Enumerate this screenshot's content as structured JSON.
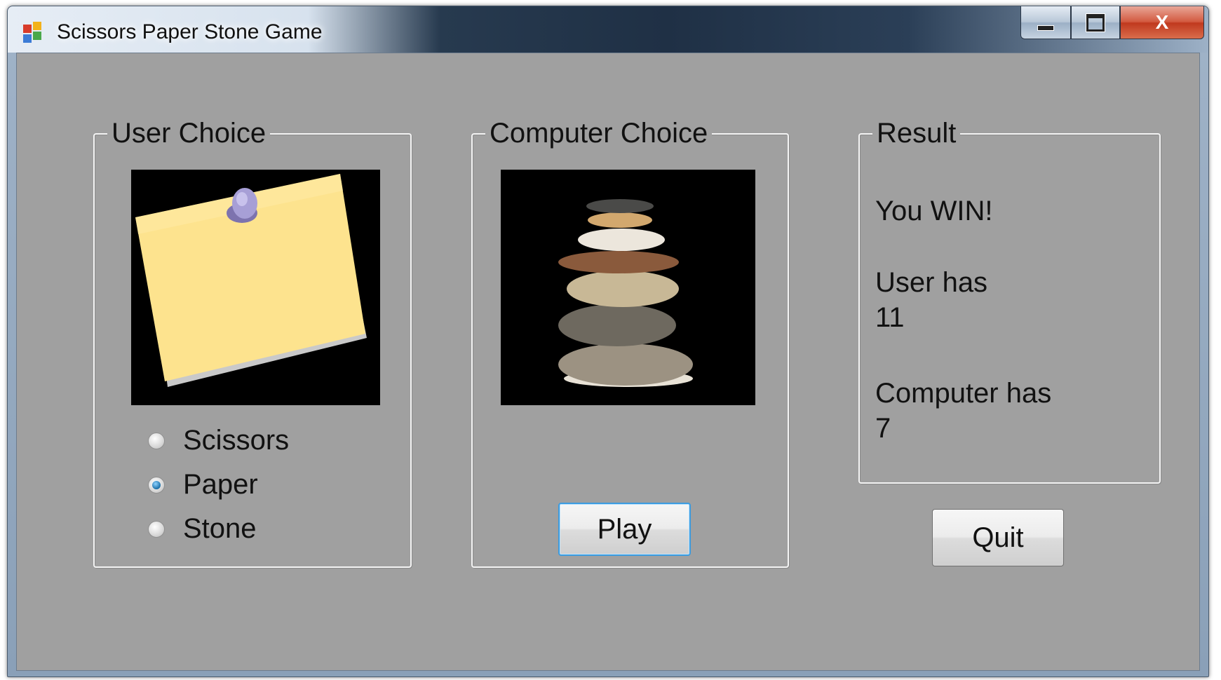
{
  "window": {
    "title": "Scissors Paper Stone Game",
    "icon": "windows-forms-app-icon",
    "buttons": {
      "minimize": "minimize-icon",
      "maximize": "maximize-icon",
      "close_label": "X"
    }
  },
  "user_group": {
    "title": "User Choice",
    "picture": "paper-note-image",
    "options": [
      {
        "label": "Scissors",
        "checked": false
      },
      {
        "label": "Paper",
        "checked": true
      },
      {
        "label": "Stone",
        "checked": false
      }
    ]
  },
  "computer_group": {
    "title": "Computer Choice",
    "picture": "stone-stack-image",
    "play_label": "Play"
  },
  "result_group": {
    "title": "Result",
    "message": "You WIN!",
    "user_label": "User has",
    "user_score": "11",
    "computer_label": "Computer has",
    "computer_score": "7"
  },
  "quit_label": "Quit",
  "colors": {
    "form_background": "#a0a0a0",
    "radio_selected": "#1b6fa8",
    "focus_border": "#3c9ce0"
  }
}
